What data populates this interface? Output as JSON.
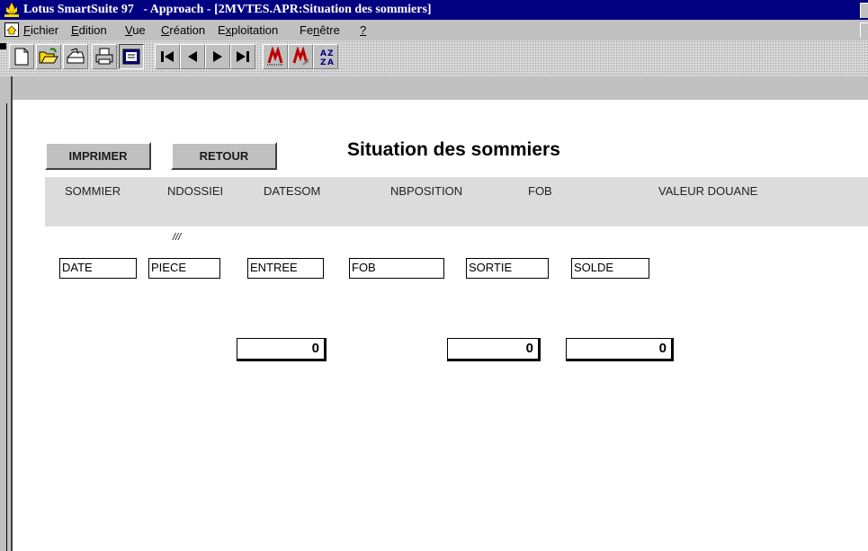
{
  "window": {
    "title": "Lotus SmartSuite 97   - Approach - [2MVTES.APR:Situation des sommiers]"
  },
  "menu": {
    "items": [
      {
        "pre": "",
        "u": "F",
        "post": "ichier"
      },
      {
        "pre": "",
        "u": "E",
        "post": "dition"
      },
      {
        "pre": "",
        "u": "V",
        "post": "ue"
      },
      {
        "pre": "",
        "u": "C",
        "post": "réation"
      },
      {
        "pre": "E",
        "u": "x",
        "post": "ploitation"
      },
      {
        "pre": "Fe",
        "u": "n",
        "post": "être"
      },
      {
        "pre": "",
        "u": "?",
        "post": ""
      }
    ]
  },
  "toolbar": {
    "icons": [
      "new-doc-icon",
      "open-folder-icon",
      "drop-box-icon",
      "print-icon",
      "browse-icon",
      "first-record-icon",
      "previous-record-icon",
      "next-record-icon",
      "last-record-icon",
      "find-icon",
      "find-special-icon",
      "sort-az-icon"
    ]
  },
  "form": {
    "title": "Situation des sommiers",
    "buttons": {
      "print": "IMPRIMER",
      "back": "RETOUR"
    },
    "header_columns": [
      "SOMMIER",
      "NDOSSIEI",
      "DATESOM",
      "NBPOSITION",
      "FOB",
      "VALEUR DOUANE"
    ],
    "mark": "///",
    "fields": [
      "DATE",
      "PIECE",
      "ENTREE",
      "FOB",
      "SORTIE",
      "SOLDE"
    ],
    "totals": {
      "entree": "0",
      "sortie": "0",
      "solde": "0"
    }
  }
}
